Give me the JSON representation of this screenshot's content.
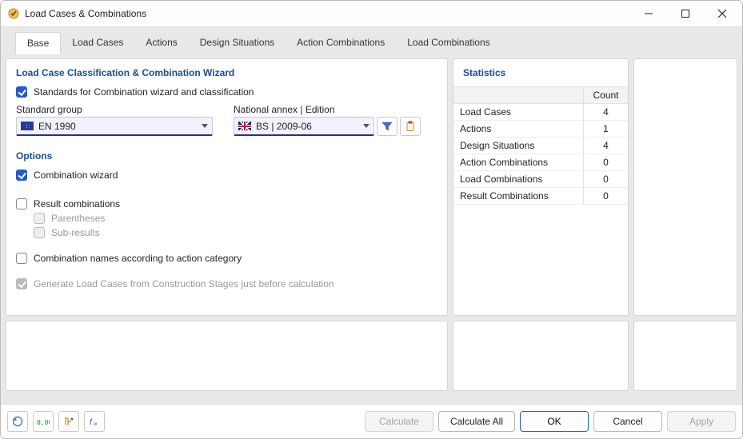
{
  "window": {
    "title": "Load Cases & Combinations"
  },
  "tabs": [
    "Base",
    "Load Cases",
    "Actions",
    "Design Situations",
    "Action Combinations",
    "Load Combinations"
  ],
  "active_tab": 0,
  "main": {
    "section1_title": "Load Case Classification & Combination Wizard",
    "standards_checkbox_label": "Standards for Combination wizard and classification",
    "standard_group_label": "Standard group",
    "standard_group_value": "EN 1990",
    "national_annex_label": "National annex | Edition",
    "national_annex_value": "BS | 2009-06",
    "options_title": "Options",
    "combination_wizard_label": "Combination wizard",
    "result_combinations_label": "Result combinations",
    "parentheses_label": "Parentheses",
    "subresults_label": "Sub-results",
    "combination_names_label": "Combination names according to action category",
    "generate_label": "Generate Load Cases from Construction Stages just before calculation"
  },
  "stats": {
    "title": "Statistics",
    "count_header": "Count",
    "rows": [
      {
        "label": "Load Cases",
        "count": "4"
      },
      {
        "label": "Actions",
        "count": "1"
      },
      {
        "label": "Design Situations",
        "count": "4"
      },
      {
        "label": "Action Combinations",
        "count": "0"
      },
      {
        "label": "Load Combinations",
        "count": "0"
      },
      {
        "label": "Result Combinations",
        "count": "0"
      }
    ]
  },
  "footer": {
    "calculate": "Calculate",
    "calculate_all": "Calculate All",
    "ok": "OK",
    "cancel": "Cancel",
    "apply": "Apply"
  }
}
